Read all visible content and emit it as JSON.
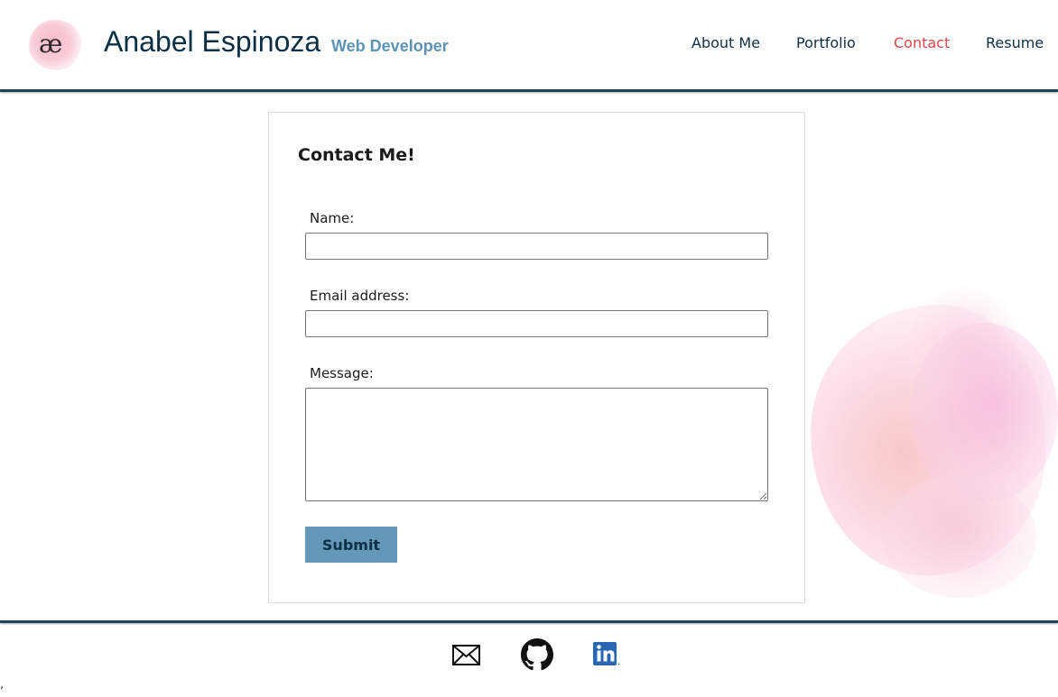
{
  "header": {
    "logo_text": "æ",
    "site_name": "Anabel Espinoza",
    "site_role": "Web Developer",
    "nav": [
      {
        "label": "About Me",
        "active": false
      },
      {
        "label": "Portfolio",
        "active": false
      },
      {
        "label": "Contact",
        "active": true
      },
      {
        "label": "Resume",
        "active": false
      }
    ]
  },
  "colors": {
    "brand_navy": "#0d2f45",
    "accent_blue": "#6498b8",
    "active_nav": "#e0454c",
    "linkedin_blue": "#2867b2"
  },
  "contact": {
    "title": "Contact Me!",
    "name_label": "Name:",
    "name_value": "",
    "email_label": "Email address:",
    "email_value": "",
    "message_label": "Message:",
    "message_value": "",
    "submit_label": "Submit"
  },
  "footer": {
    "icons": [
      "envelope-icon",
      "github-icon",
      "linkedin-icon"
    ],
    "stray_text": ","
  }
}
